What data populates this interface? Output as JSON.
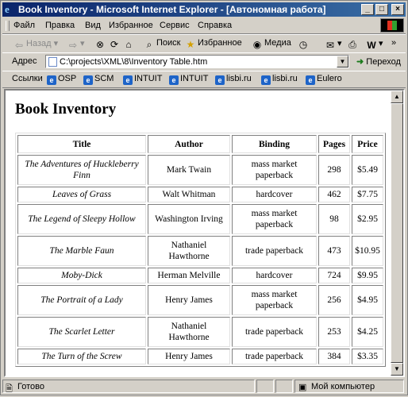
{
  "window": {
    "title": "Book Inventory - Microsoft Internet Explorer - [Автономная работа]",
    "icon": "ie-icon"
  },
  "menu": [
    "Файл",
    "Правка",
    "Вид",
    "Избранное",
    "Сервис",
    "Справка"
  ],
  "toolbar": {
    "back": "Назад",
    "search": "Поиск",
    "favorites": "Избранное",
    "media": "Медиа"
  },
  "address": {
    "label": "Адрес",
    "value": "C:\\projects\\XML\\8\\Inventory Table.htm",
    "go_label": "Переход"
  },
  "links": {
    "label": "Ссылки",
    "items": [
      "OSP",
      "SCM",
      "INTUIT",
      "INTUIT",
      "lisbi.ru",
      "lisbi.ru",
      "Eulero"
    ]
  },
  "document": {
    "heading": "Book Inventory",
    "columns": [
      "Title",
      "Author",
      "Binding",
      "Pages",
      "Price"
    ],
    "rows": [
      {
        "title": "The Adventures of Huckleberry Finn",
        "author": "Mark Twain",
        "binding": "mass market paperback",
        "pages": "298",
        "price": "$5.49"
      },
      {
        "title": "Leaves of Grass",
        "author": "Walt Whitman",
        "binding": "hardcover",
        "pages": "462",
        "price": "$7.75"
      },
      {
        "title": "The Legend of Sleepy Hollow",
        "author": "Washington Irving",
        "binding": "mass market paperback",
        "pages": "98",
        "price": "$2.95"
      },
      {
        "title": "The Marble Faun",
        "author": "Nathaniel Hawthorne",
        "binding": "trade paperback",
        "pages": "473",
        "price": "$10.95"
      },
      {
        "title": "Moby-Dick",
        "author": "Herman Melville",
        "binding": "hardcover",
        "pages": "724",
        "price": "$9.95"
      },
      {
        "title": "The Portrait of a Lady",
        "author": "Henry James",
        "binding": "mass market paperback",
        "pages": "256",
        "price": "$4.95"
      },
      {
        "title": "The Scarlet Letter",
        "author": "Nathaniel Hawthorne",
        "binding": "trade paperback",
        "pages": "253",
        "price": "$4.25"
      },
      {
        "title": "The Turn of the Screw",
        "author": "Henry James",
        "binding": "trade paperback",
        "pages": "384",
        "price": "$3.35"
      }
    ]
  },
  "status": {
    "left": "Готово",
    "zone": "Мой компьютер"
  },
  "colors": {
    "titlebar_start": "#0a246a",
    "titlebar_end": "#3a6ea5",
    "chrome": "#d4d0c8"
  }
}
